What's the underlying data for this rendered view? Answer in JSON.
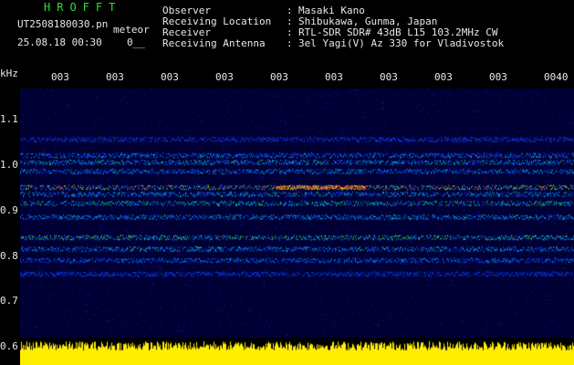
{
  "header": {
    "program": "HROFFT",
    "filename": "UT2508180030.pn",
    "mode": "meteor",
    "datetime": "25.08.18 00:30",
    "counter": "0__",
    "fields": [
      {
        "label": "Observer",
        "sep": ":",
        "value": "Masaki Kano"
      },
      {
        "label": "Receiving Location",
        "sep": ":",
        "value": "Shibukawa, Gunma, Japan"
      },
      {
        "label": "Receiver",
        "sep": ":",
        "value": "RTL-SDR SDR# 43dB L15 103.2MHz CW"
      },
      {
        "label": "Receiving Antenna",
        "sep": ":",
        "value": "3el Yagi(V) Az 330 for Vladivostok"
      }
    ]
  },
  "axes": {
    "y_unit": "kHz",
    "y_ticks": [
      "1.1",
      "1.0",
      "0.9",
      "0.8",
      "0.7",
      "0.6"
    ],
    "x_ticks": [
      "003",
      "003",
      "003",
      "003",
      "003",
      "003",
      "003",
      "003",
      "003",
      "0040"
    ]
  },
  "spectrogram": {
    "background": "#000035",
    "signal_colors": [
      "#1040ff",
      "#00c8ff",
      "#30e030",
      "#ffe000",
      "#ff3030"
    ],
    "bands": [
      {
        "freq_khz": 1.055,
        "level": 0.25
      },
      {
        "freq_khz": 1.02,
        "level": 0.45
      },
      {
        "freq_khz": 1.005,
        "level": 0.55
      },
      {
        "freq_khz": 0.985,
        "level": 0.5
      },
      {
        "freq_khz": 0.95,
        "level": 1.0
      },
      {
        "freq_khz": 0.935,
        "level": 0.55
      },
      {
        "freq_khz": 0.915,
        "level": 0.7
      },
      {
        "freq_khz": 0.885,
        "level": 0.55
      },
      {
        "freq_khz": 0.84,
        "level": 0.75
      },
      {
        "freq_khz": 0.815,
        "level": 0.55
      },
      {
        "freq_khz": 0.79,
        "level": 0.4
      },
      {
        "freq_khz": 0.76,
        "level": 0.2
      }
    ]
  },
  "power_bar": {
    "color": "#ffee00"
  }
}
